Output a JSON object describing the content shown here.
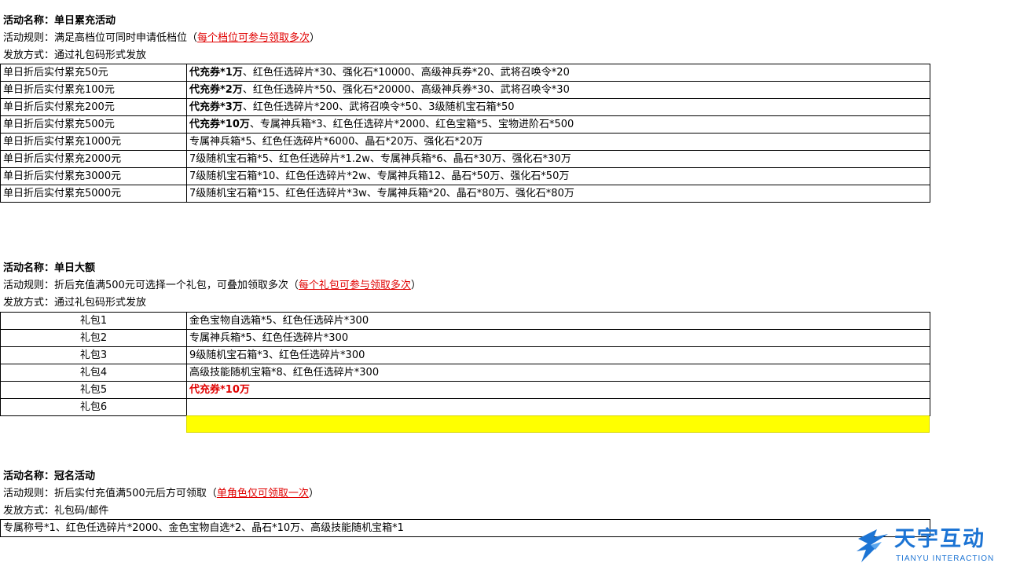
{
  "section1": {
    "title_label": "活动名称：",
    "title_value": "单日累充活动",
    "rule_label": "活动规则：",
    "rule_text": "满足高档位可同时申请低档位（",
    "rule_red": "每个档位可参与领取多次",
    "rule_close": "）",
    "delivery_label": "发放方式：",
    "delivery_text": "通过礼包码形式发放",
    "rows": [
      {
        "tier": "单日折后实付累充50元",
        "bold": "代充券*1万",
        "rest": "、红色任选碎片*30、强化石*10000、高级神兵券*20、武将召唤令*20"
      },
      {
        "tier": "单日折后实付累充100元",
        "bold": "代充券*2万",
        "rest": "、红色任选碎片*50、强化石*20000、高级神兵券*30、武将召唤令*30"
      },
      {
        "tier": "单日折后实付累充200元",
        "bold": "代充券*3万",
        "rest": "、红色任选碎片*200、武将召唤令*50、3级随机宝石箱*50"
      },
      {
        "tier": "单日折后实付累充500元",
        "bold": "代充券*10万",
        "rest": "、专属神兵箱*3、红色任选碎片*2000、红色宝箱*5、宝物进阶石*500"
      },
      {
        "tier": "单日折后实付累充1000元",
        "bold": "",
        "rest": "专属神兵箱*5、红色任选碎片*6000、晶石*20万、强化石*20万"
      },
      {
        "tier": "单日折后实付累充2000元",
        "bold": "",
        "rest": "7级随机宝石箱*5、红色任选碎片*1.2w、专属神兵箱*6、晶石*30万、强化石*30万"
      },
      {
        "tier": "单日折后实付累充3000元",
        "bold": "",
        "rest": "7级随机宝石箱*10、红色任选碎片*2w、专属神兵箱12、晶石*50万、强化石*50万"
      },
      {
        "tier": "单日折后实付累充5000元",
        "bold": "",
        "rest": "7级随机宝石箱*15、红色任选碎片*3w、专属神兵箱*20、晶石*80万、强化石*80万"
      }
    ]
  },
  "section2": {
    "title_label": "活动名称：",
    "title_value": "单日大额",
    "rule_label": "活动规则：",
    "rule_text": "折后充值满500元可选择一个礼包，可叠加领取多次（",
    "rule_red": "每个礼包可参与领取多次",
    "rule_close": "）",
    "delivery_label": "发放方式：",
    "delivery_text": "通过礼包码形式发放",
    "rows": [
      {
        "name": "礼包1",
        "content": "金色宝物自选箱*5、红色任选碎片*300",
        "red": false
      },
      {
        "name": "礼包2",
        "content": "专属神兵箱*5、红色任选碎片*300",
        "red": false
      },
      {
        "name": "礼包3",
        "content": "9级随机宝石箱*3、红色任选碎片*300",
        "red": false
      },
      {
        "name": "礼包4",
        "content": "高级技能随机宝箱*8、红色任选碎片*300",
        "red": false
      },
      {
        "name": "礼包5",
        "content": "代充券*10万",
        "red": true
      },
      {
        "name": "礼包6",
        "content": "",
        "red": false
      }
    ]
  },
  "section3": {
    "title_label": "活动名称：",
    "title_value": "冠名活动",
    "rule_label": "活动规则：",
    "rule_text": "折后实付充值满500元后方可领取（",
    "rule_red": "单角色仅可领取一次",
    "rule_close": "）",
    "delivery_label": "发放方式：",
    "delivery_text": "礼包码/邮件",
    "reward": "专属称号*1、红色任选碎片*2000、金色宝物自选*2、晶石*10万、高级技能随机宝箱*1"
  },
  "logo": {
    "cn": "天宇互动",
    "en": "TIANYU INTERACTION",
    "color": "#1c74d4"
  },
  "colors": {
    "red": "#e00000",
    "highlight": "#ffff00"
  }
}
